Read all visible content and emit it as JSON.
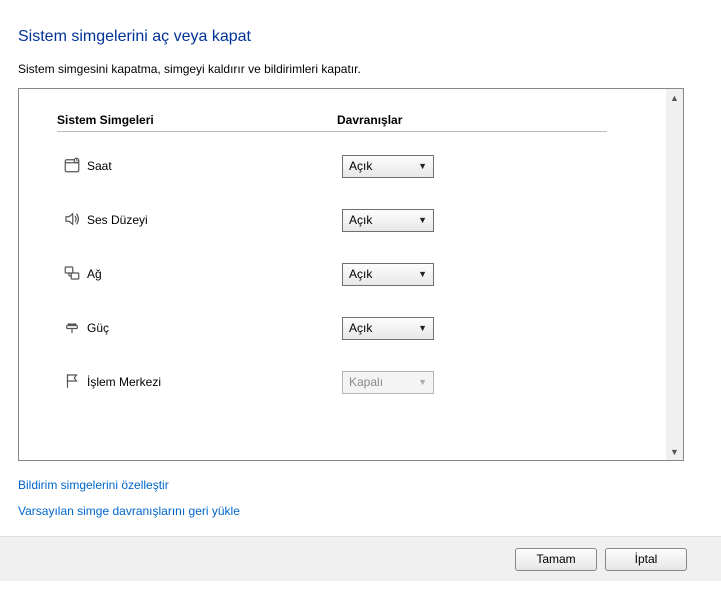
{
  "title": "Sistem simgelerini aç veya kapat",
  "description": "Sistem simgesini kapatma, simgeyi kaldırır ve bildirimleri kapatır.",
  "columns": {
    "system_icons": "Sistem Simgeleri",
    "behaviors": "Davranışlar"
  },
  "rows": [
    {
      "icon": "clock-icon",
      "label": "Saat",
      "value": "Açık",
      "enabled": true
    },
    {
      "icon": "volume-icon",
      "label": "Ses Düzeyi",
      "value": "Açık",
      "enabled": true
    },
    {
      "icon": "network-icon",
      "label": "Ağ",
      "value": "Açık",
      "enabled": true
    },
    {
      "icon": "power-icon",
      "label": "Güç",
      "value": "Açık",
      "enabled": true
    },
    {
      "icon": "flag-icon",
      "label": "İşlem Merkezi",
      "value": "Kapalı",
      "enabled": false
    }
  ],
  "links": {
    "customize": "Bildirim simgelerini özelleştir",
    "restore": "Varsayılan simge davranışlarını geri yükle"
  },
  "buttons": {
    "ok": "Tamam",
    "cancel": "İptal"
  }
}
